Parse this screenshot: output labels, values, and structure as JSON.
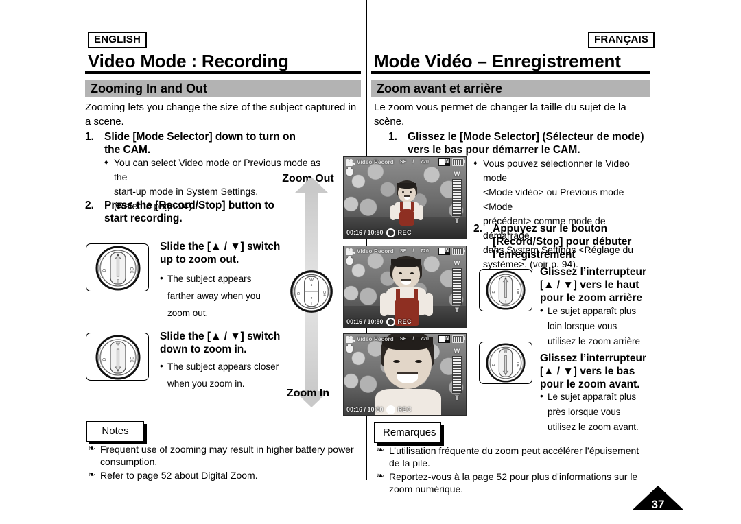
{
  "document": {
    "page_number": "37"
  },
  "english": {
    "language_tag": "ENGLISH",
    "page_title": "Video Mode : Recording",
    "section_title": "Zooming In and Out",
    "intro": "Zooming lets you change the size of the subject captured in a scene.",
    "step1": {
      "number": "1.",
      "text": "Slide [Mode Selector] down to turn on the CAM.",
      "bullets": [
        {
          "marker": "♦",
          "line1": "You can select Video mode or Previous mode as the",
          "line2": "start-up mode in System Settings.",
          "line3": "(Refer to page 94)"
        }
      ]
    },
    "step2": {
      "number": "2.",
      "text": "Press the [Record/Stop] button to start recording."
    },
    "zoom_out": {
      "instruction": "Slide the [▲ / ▼] switch up to zoom out.",
      "note_marker": "•",
      "note_line1": "The subject appears",
      "note_line2": "farther away when you",
      "note_line3": "zoom out."
    },
    "zoom_in": {
      "instruction": "Slide the [▲ / ▼] switch down to zoom in.",
      "note_marker": "•",
      "note_line1": "The subject appears closer",
      "note_line2": "when you zoom in."
    },
    "notes": {
      "heading": "Notes",
      "items": [
        {
          "marker": "❧",
          "text": "Frequent use of zooming may result in higher battery power consumption."
        },
        {
          "marker": "❧",
          "text": "Refer to page 52 about Digital Zoom."
        }
      ]
    }
  },
  "french": {
    "language_tag": "FRANÇAIS",
    "page_title": "Mode Vidéo – Enregistrement",
    "section_title": "Zoom avant et arrière",
    "intro": "Le zoom vous permet de changer la taille du sujet de la scène.",
    "step1": {
      "number": "1.",
      "text": "Glissez le [Mode Selector] (Sélecteur de mode) vers le bas pour démarrer le CAM.",
      "bullets": [
        {
          "marker": "♦",
          "line1": "Vous pouvez sélectionner le Video mode",
          "line2": "<Mode vidéo> ou Previous mode <Mode",
          "line3": "précédent> comme mode de démarrage",
          "line4": "dans System Settings <Réglage du",
          "line5": "système>. (voir p. 94)."
        }
      ]
    },
    "step2": {
      "number": "2.",
      "text": "Appuyez sur le bouton [Record/Stop] pour débuter l’enregistrement"
    },
    "zoom_out": {
      "instruction": "Glissez l’interrupteur [▲ / ▼] vers le haut pour le zoom arrière",
      "note_marker": "•",
      "note_line1": "Le sujet apparaît plus",
      "note_line2": "loin lorsque vous",
      "note_line3": "utilisez le zoom arrière"
    },
    "zoom_in": {
      "instruction": "Glissez l’interrupteur [▲ / ▼] vers le bas pour le zoom avant.",
      "note_marker": "•",
      "note_line1": "Le sujet apparaît plus",
      "note_line2": "près lorsque vous",
      "note_line3": "utilisez le zoom avant."
    },
    "notes": {
      "heading": "Remarques",
      "items": [
        {
          "marker": "❧",
          "text": "L’utilisation fréquente du zoom peut accélérer l’épuisement de la pile."
        },
        {
          "marker": "❧",
          "text": "Reportez-vous à la page 52 pour plus d'informations sur le zoom numérique."
        }
      ]
    }
  },
  "zoom_arrow": {
    "top_label": "Zoom Out",
    "bottom_label": "Zoom In"
  },
  "lcd_screens": [
    {
      "mode_label": "Video Record",
      "quality": "SF",
      "separator": "/",
      "resolution": "720",
      "zoom_top": "W",
      "zoom_bottom": "T",
      "timecode": "00:16 / 10:50",
      "rec_label": "REC",
      "zoom_level": "wide"
    },
    {
      "mode_label": "Video Record",
      "quality": "SF",
      "separator": "/",
      "resolution": "720",
      "zoom_top": "W",
      "zoom_bottom": "T",
      "timecode": "00:16 / 10:50",
      "rec_label": "REC",
      "zoom_level": "medium"
    },
    {
      "mode_label": "Video Record",
      "quality": "SF",
      "separator": "/",
      "resolution": "720",
      "zoom_top": "W",
      "zoom_bottom": "T",
      "timecode": "00:16 / 10:50",
      "rec_label": "REC",
      "zoom_level": "tele"
    }
  ],
  "switch_labels": {
    "w": "W",
    "t": "T",
    "left": "D",
    "right": "OK"
  },
  "colors": {
    "section_bar": "#b3b3b3",
    "arrow": "#c9c9c9",
    "rule": "#000000"
  }
}
